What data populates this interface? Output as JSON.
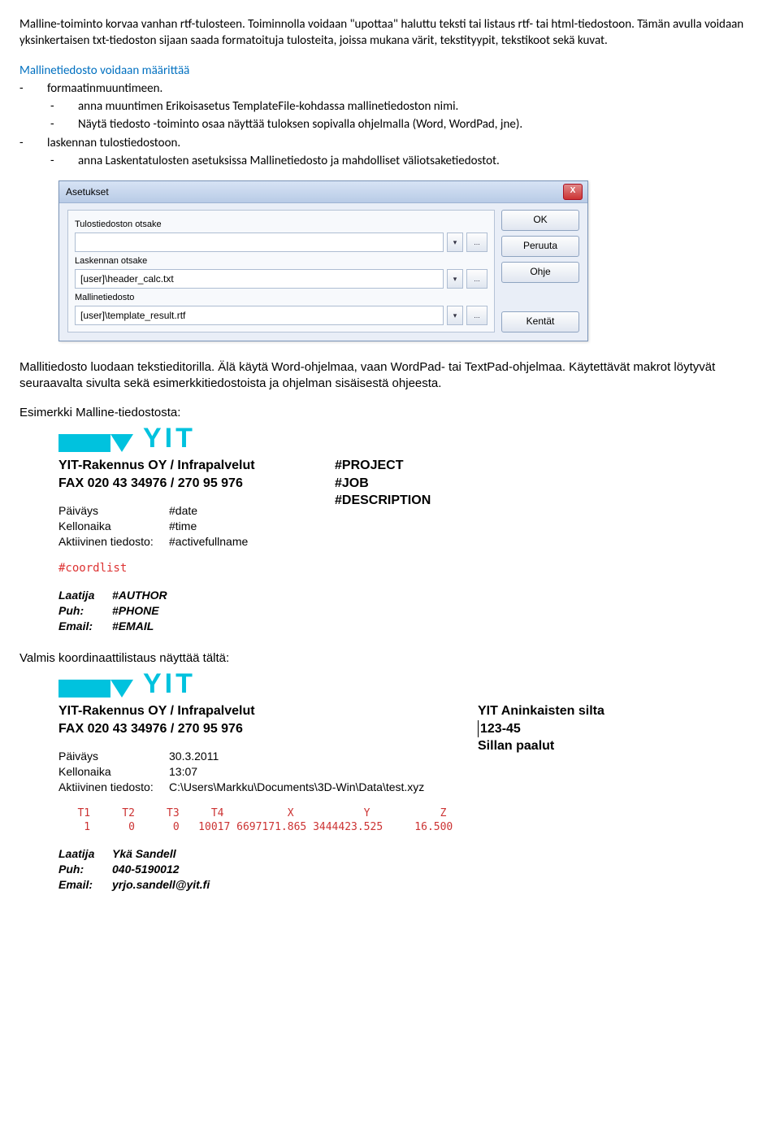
{
  "intro": {
    "p1": "Malline-toiminto korvaa vanhan rtf-tulosteen. Toiminnolla voidaan \"upottaa\" haluttu teksti tai listaus rtf- tai html-tiedostoon. Tämän avulla voidaan yksinkertaisen txt-tiedoston sijaan saada formatoituja tulosteita, joissa mukana värit, tekstityypit, tekstikoot sekä kuvat.",
    "p2": "Mallinetiedosto voidaan määrittää",
    "b1": "formaatinmuuntimeen.",
    "b2": "anna muuntimen Erikoisasetus TemplateFile-kohdassa mallinetiedoston nimi.",
    "b3": "Näytä tiedosto -toiminto osaa näyttää tuloksen sopivalla ohjelmalla (Word, WordPad, jne).",
    "b4": "laskennan tulostiedostoon.",
    "b5": "anna Laskentatulosten asetuksissa Mallinetiedosto ja mahdolliset väliotsaketiedostot."
  },
  "dialog": {
    "title": "Asetukset",
    "labels": {
      "f1": "Tulostiedoston otsake",
      "f2": "Laskennan otsake",
      "f3": "Mallinetiedosto"
    },
    "values": {
      "f1": "",
      "f2": "[user]\\header_calc.txt",
      "f3": "[user]\\template_result.rtf"
    },
    "buttons": {
      "ok": "OK",
      "cancel": "Peruuta",
      "help": "Ohje",
      "fields": "Kentät"
    },
    "close": "X",
    "chev": "▾",
    "dots": "..."
  },
  "mid": {
    "p1": "Mallitiedosto luodaan tekstieditorilla. Älä käytä Word-ohjelmaa, vaan WordPad- tai TextPad-ohjelmaa. Käytettävät makrot löytyvät seuraavalta sivulta sekä esimerkkitiedostoista ja ohjelman sisäisestä ohjeesta.",
    "p2": "Esimerkki Malline-tiedostosta:"
  },
  "sample1": {
    "logo": "YIT",
    "left": {
      "l1": "YIT-Rakennus OY / Infrapalvelut",
      "l2": "FAX 020 43 34976 / 270 95 976",
      "rows": [
        {
          "k": "Päiväys",
          "v": "#date"
        },
        {
          "k": "Kellonaika",
          "v": "#time"
        },
        {
          "k": "Aktiivinen tiedosto:",
          "v": "#activefullname"
        }
      ],
      "coord": "#coordlist",
      "foot": [
        {
          "k": "Laatija",
          "v": "#AUTHOR"
        },
        {
          "k": "Puh:",
          "v": "#PHONE"
        },
        {
          "k": "Email:",
          "v": "#EMAIL"
        }
      ]
    },
    "right": [
      "#PROJECT",
      "#JOB",
      "#DESCRIPTION"
    ]
  },
  "mid2": "Valmis koordinaattilistaus näyttää tältä:",
  "sample2": {
    "logo": "YIT",
    "left": {
      "l1": "YIT-Rakennus OY / Infrapalvelut",
      "l2": "FAX 020 43 34976 / 270 95 976",
      "rows": [
        {
          "k": "Päiväys",
          "v": "30.3.2011"
        },
        {
          "k": "Kellonaika",
          "v": "13:07"
        },
        {
          "k": "Aktiivinen tiedosto:",
          "v": "C:\\Users\\Markku\\Documents\\3D-Win\\Data\\test.xyz"
        }
      ],
      "coordhdr": "   T1     T2     T3     T4          X           Y           Z",
      "coordrow": "    1      0      0   10017 6697171.865 3444423.525     16.500",
      "foot": [
        {
          "k": "Laatija",
          "v": "Ykä Sandell"
        },
        {
          "k": "Puh:",
          "v": "040-5190012"
        },
        {
          "k": "Email:",
          "v": "yrjo.sandell@yit.fi"
        }
      ]
    },
    "right": [
      "YIT Aninkaisten silta",
      "123-45",
      "Sillan paalut"
    ]
  }
}
